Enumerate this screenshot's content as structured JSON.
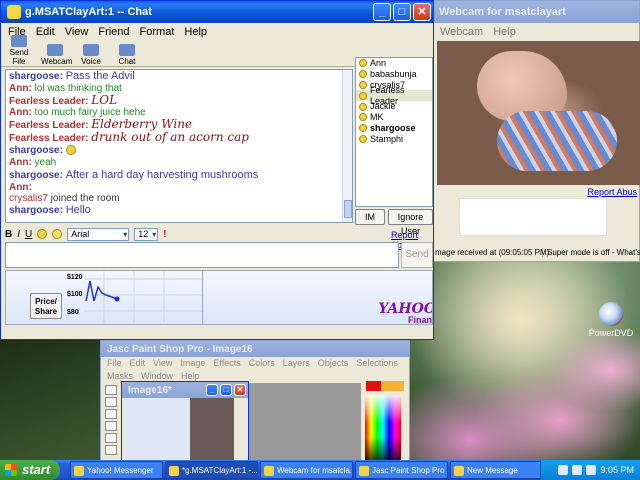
{
  "chat_window": {
    "title": "g.MSATClayArt:1 -- Chat",
    "menu": [
      "File",
      "Edit",
      "View",
      "Friend",
      "Format",
      "Help"
    ],
    "toolbar": [
      "Send File",
      "Webcam",
      "Voice",
      "Chat"
    ],
    "messages": [
      {
        "name": "shargoose:",
        "text": "Pass the Advil",
        "name_color": "#3a3ab0",
        "text_color": "#3a3ab0",
        "style": "mid"
      },
      {
        "name": "Ann:",
        "text": "lol was thinking that",
        "name_color": "#b03030",
        "text_color": "#228822",
        "style": "normal"
      },
      {
        "name": "Fearless Leader:",
        "text": "LOL",
        "name_color": "#b03030",
        "text_color": "#8a1010",
        "style": "fancy"
      },
      {
        "name": "Ann:",
        "text": "too much fairy juice hehe",
        "name_color": "#b03030",
        "text_color": "#228822",
        "style": "normal"
      },
      {
        "name": "Fearless Leader:",
        "text": "Elderberry Wine",
        "name_color": "#b03030",
        "text_color": "#8a1010",
        "style": "fancy"
      },
      {
        "name": "Fearless Leader:",
        "text": "drunk out of an acorn cap",
        "name_color": "#b03030",
        "text_color": "#8a1010",
        "style": "fancy"
      },
      {
        "name": "shargoose:",
        "text": "",
        "name_color": "#3a3ab0",
        "text_color": "#3a3ab0",
        "style": "smile"
      },
      {
        "name": "Ann:",
        "text": "yeah",
        "name_color": "#b03030",
        "text_color": "#228822",
        "style": "normal"
      },
      {
        "name": "shargoose:",
        "text": "After a hard day harvesting mushrooms",
        "name_color": "#3a3ab0",
        "text_color": "#3a3ab0",
        "style": "mid"
      },
      {
        "name": "Ann:",
        "text": "",
        "name_color": "#b03030",
        "text_color": "#228822",
        "style": "normal"
      },
      {
        "name": "crysalis7",
        "text": " joined the room",
        "name_color": "#b03030",
        "text_color": "#333333",
        "style": "join"
      },
      {
        "name": "shargoose:",
        "text": "Hello",
        "name_color": "#3a3ab0",
        "text_color": "#3a3ab0",
        "style": "mid"
      }
    ],
    "friends": [
      {
        "name": "Ann",
        "bold": false,
        "selected": false
      },
      {
        "name": "babasbunja",
        "bold": false,
        "selected": false
      },
      {
        "name": "crysalis7",
        "bold": false,
        "selected": false
      },
      {
        "name": "Fearless Leader",
        "bold": false,
        "selected": true
      },
      {
        "name": "Jackie",
        "bold": false,
        "selected": false
      },
      {
        "name": "MK",
        "bold": false,
        "selected": false
      },
      {
        "name": "shargoose",
        "bold": true,
        "selected": false
      },
      {
        "name": "Stamphi",
        "bold": false,
        "selected": false
      }
    ],
    "im_label": "IM",
    "ignore_label": "Ignore User",
    "format": {
      "bold": "B",
      "italic": "I",
      "underline": "U",
      "font": "Arial",
      "size": "12"
    },
    "report_abuse": "Report Abuse",
    "send_label": "Send",
    "ticker": {
      "button": "Price/ Share",
      "y_labels": [
        "$120",
        "$100",
        "$80"
      ],
      "brand": "YAHOO",
      "brand_sub": "Finan"
    }
  },
  "webcam_window": {
    "title": "Webcam for msatclayart",
    "menu": [
      "Webcam",
      "Help"
    ],
    "report_abuse": "Report Abus",
    "status_received": "mage received at (09:05:05 PM)",
    "status_super": "Super mode is off - What's thi"
  },
  "psp_window": {
    "title": "Jasc Paint Shop Pro - Image16",
    "menu": [
      "File",
      "Edit",
      "View",
      "Image",
      "Effects",
      "Colors",
      "Layers",
      "Objects",
      "Selections",
      "Masks",
      "Window",
      "Help"
    ],
    "image_title": "Image16*"
  },
  "desktop_icon": "PowerDVD",
  "taskbar": {
    "start": "start",
    "tasks": [
      "Yahoo! Messenger",
      "*g.MSATClayArt:1 -...",
      "Webcam for msatcla...",
      "Jasc Paint Shop Pro ...",
      "New Message"
    ],
    "clock": "9:05 PM"
  }
}
